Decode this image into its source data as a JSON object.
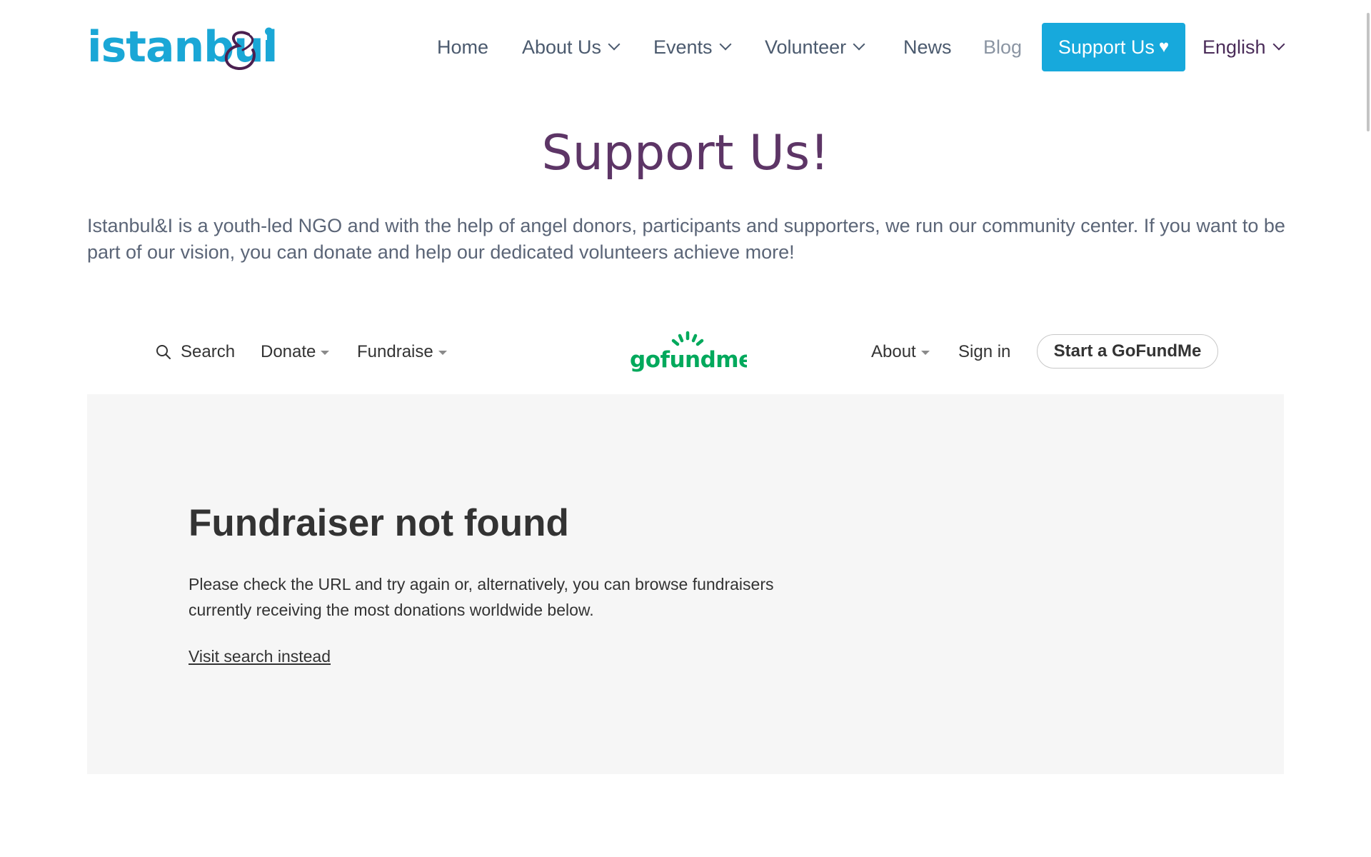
{
  "header": {
    "logo_text": "istanbul",
    "logo_alt": "istanbul&i",
    "nav": {
      "home": "Home",
      "about": "About Us",
      "events": "Events",
      "volunteer": "Volunteer",
      "news": "News",
      "blog": "Blog",
      "support": "Support Us",
      "support_icon": "♥",
      "language": "English"
    }
  },
  "main": {
    "title": "Support Us!",
    "intro": "Istanbul&I is a youth-led NGO and with the help of angel donors, participants and supporters, we run our community center. If you want to be part of our vision, you can donate and help our dedicated volunteers achieve more!"
  },
  "gofundme": {
    "nav": {
      "search": "Search",
      "donate": "Donate",
      "fundraise": "Fundraise",
      "about": "About",
      "sign_in": "Sign in",
      "start": "Start a GoFundMe"
    },
    "logo_text": "gofundme",
    "not_found_title": "Fundraiser not found",
    "not_found_body": "Please check the URL and try again or, alternatively, you can browse fundraisers currently receiving the most donations worldwide below.",
    "visit_search": "Visit search instead"
  },
  "colors": {
    "brand_blue": "#17a9dc",
    "brand_purple": "#5d3566",
    "gofundme_green": "#02a95c"
  }
}
